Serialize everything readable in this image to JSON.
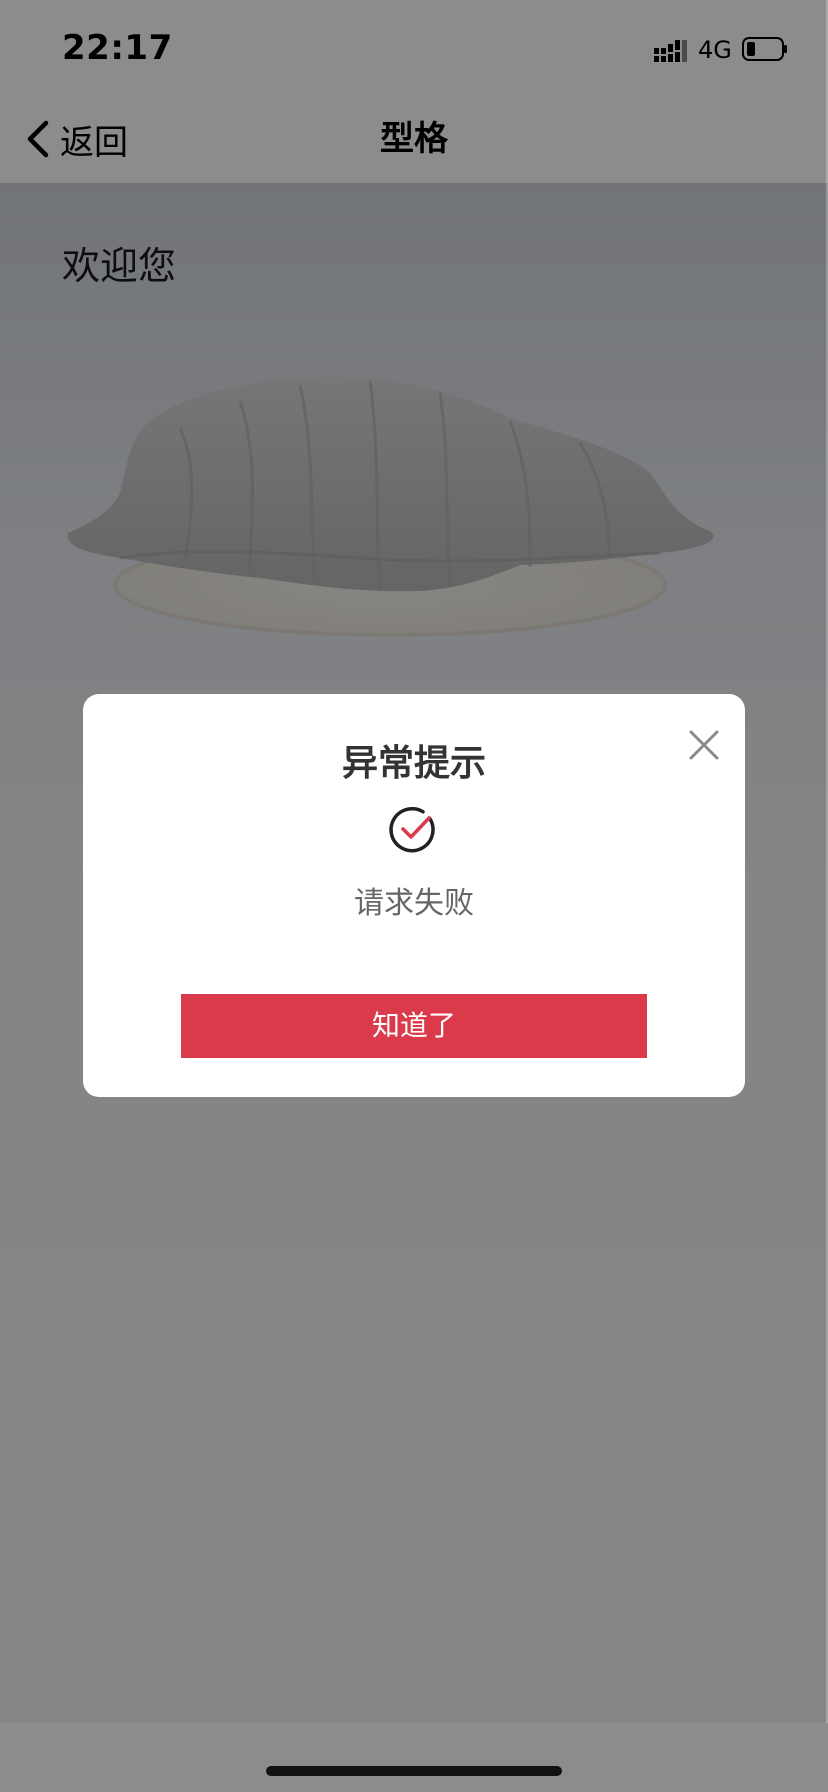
{
  "status_bar": {
    "time": "22:17",
    "network": "4G"
  },
  "nav": {
    "back_label": "返回",
    "title": "型格"
  },
  "content": {
    "welcome_text": "欢迎您"
  },
  "dialog": {
    "title": "异常提示",
    "message": "请求失败",
    "confirm_label": "知道了",
    "accent_color": "#da3a4a"
  },
  "icons": {
    "back": "chevron-left-icon",
    "close": "close-icon",
    "status": "check-circle-icon",
    "signal": "signal-icon",
    "battery": "battery-icon"
  }
}
